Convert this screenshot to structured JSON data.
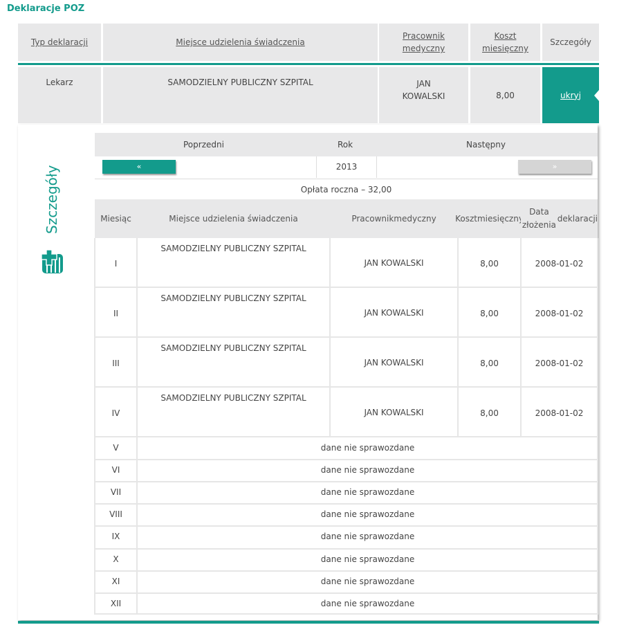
{
  "page": {
    "title": "Deklaracje POZ"
  },
  "main_table": {
    "headers": {
      "type": "Typ deklaracji",
      "place": "Miejsce udzielenia świadczenia",
      "worker_line1": "Pracownik",
      "worker_line2": "medyczny",
      "cost_line1": "Koszt",
      "cost_line2": "miesięczny",
      "details": "Szczegóły"
    },
    "row": {
      "type": "Lekarz",
      "place": "SAMODZIELNY PUBLICZNY SZPITAL",
      "worker_line1": "JAN",
      "worker_line2": "KOWALSKI",
      "cost": "8,00",
      "toggle": "ukryj"
    }
  },
  "details": {
    "side_label": "Szczegóły",
    "nav": {
      "prev_label": "Poprzedni",
      "year_label": "Rok",
      "next_label": "Następny",
      "prev_button": "«",
      "year": "2013",
      "next_button": "»"
    },
    "annual_fee": "Opłata roczna – 32,00",
    "columns": {
      "month": "Miesiąc",
      "place": "Miejsce udzielenia świadczenia",
      "worker_line1": "Pracownik",
      "worker_line2": "medyczny",
      "cost_line1": "Koszt",
      "cost_line2": "miesięczny",
      "date_line1": "Data złożenia",
      "date_line2": "deklaracji"
    },
    "rows": [
      {
        "month": "I",
        "place": "SAMODZIELNY PUBLICZNY SZPITAL",
        "worker": "JAN  KOWALSKI",
        "cost": "8,00",
        "date": "2008-01-02"
      },
      {
        "month": "II",
        "place": "SAMODZIELNY PUBLICZNY SZPITAL",
        "worker": "JAN  KOWALSKI",
        "cost": "8,00",
        "date": "2008-01-02"
      },
      {
        "month": "III",
        "place": "SAMODZIELNY PUBLICZNY SZPITAL",
        "worker": "JAN  KOWALSKI",
        "cost": "8,00",
        "date": "2008-01-02"
      },
      {
        "month": "IV",
        "place": "SAMODZIELNY PUBLICZNY SZPITAL",
        "worker": "JAN  KOWALSKI",
        "cost": "8,00",
        "date": "2008-01-02"
      }
    ],
    "empty_rows": [
      {
        "month": "V",
        "text": "dane nie sprawozdane"
      },
      {
        "month": "VI",
        "text": "dane nie sprawozdane"
      },
      {
        "month": "VII",
        "text": "dane nie sprawozdane"
      },
      {
        "month": "VIII",
        "text": "dane nie sprawozdane"
      },
      {
        "month": "IX",
        "text": "dane nie sprawozdane"
      },
      {
        "month": "X",
        "text": "dane nie sprawozdane"
      },
      {
        "month": "XI",
        "text": "dane nie sprawozdane"
      },
      {
        "month": "XII",
        "text": "dane nie sprawozdane"
      }
    ]
  },
  "colors": {
    "accent": "#139b8c",
    "header_bg": "#e8e8e9"
  }
}
